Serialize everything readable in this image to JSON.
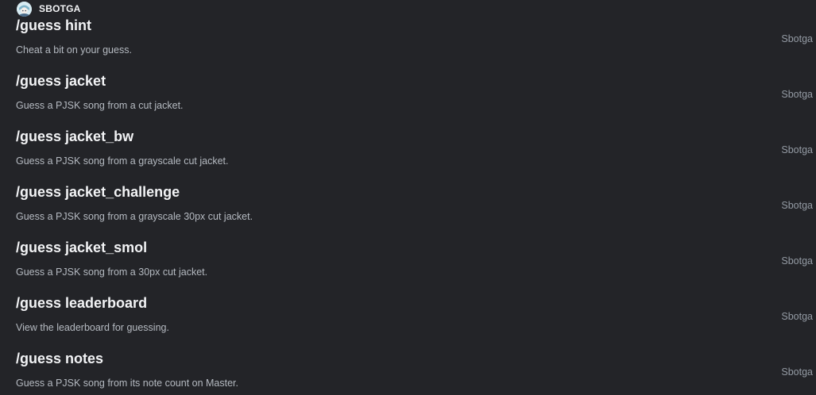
{
  "header": {
    "bot_name": "SBOTGA",
    "avatar_icon": "bot-avatar-icon"
  },
  "commands": [
    {
      "name": "/guess hint",
      "description": "Cheat a bit on your guess.",
      "source": "Sbotga"
    },
    {
      "name": "/guess jacket",
      "description": "Guess a PJSK song from a cut jacket.",
      "source": "Sbotga"
    },
    {
      "name": "/guess jacket_bw",
      "description": "Guess a PJSK song from a grayscale cut jacket.",
      "source": "Sbotga"
    },
    {
      "name": "/guess jacket_challenge",
      "description": "Guess a PJSK song from a grayscale 30px cut jacket.",
      "source": "Sbotga"
    },
    {
      "name": "/guess jacket_smol",
      "description": "Guess a PJSK song from a 30px cut jacket.",
      "source": "Sbotga"
    },
    {
      "name": "/guess leaderboard",
      "description": "View the leaderboard for guessing.",
      "source": "Sbotga"
    },
    {
      "name": "/guess notes",
      "description": "Guess a PJSK song from its note count on Master.",
      "source": "Sbotga"
    }
  ],
  "colors": {
    "background": "#232428",
    "command_text": "#f2f3f5",
    "description_text": "#b5bac1",
    "source_text": "#949ba4"
  }
}
